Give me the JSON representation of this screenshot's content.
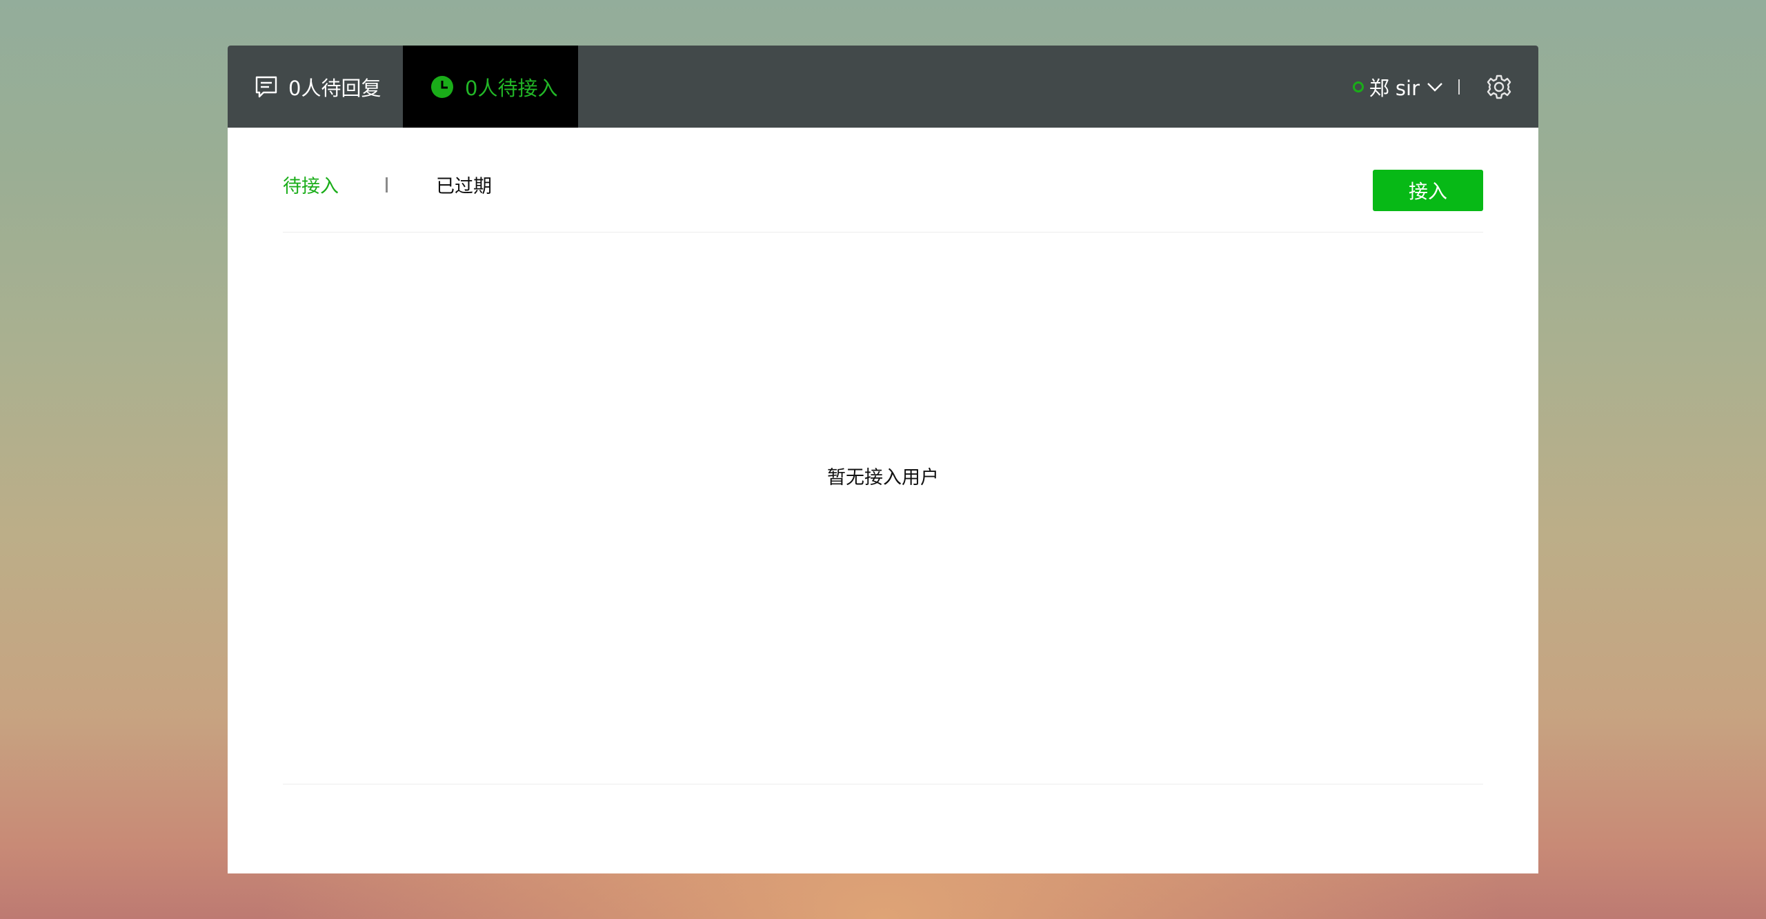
{
  "header": {
    "tab_reply_label": "0人待回复",
    "tab_waiting_label": "0人待接入",
    "user_name": "郑 sir",
    "status_color": "#1aad19",
    "accent_color": "#22b727",
    "icons": {
      "reply": "chat-list-icon",
      "waiting": "clock-icon",
      "dropdown": "chevron-down-icon",
      "settings": "gear-icon"
    }
  },
  "subtabs": {
    "waiting_label": "待接入",
    "expired_label": "已过期"
  },
  "actions": {
    "accept_label": "接入",
    "accept_color": "#07b916"
  },
  "empty_state": {
    "message": "暂无接入用户"
  }
}
